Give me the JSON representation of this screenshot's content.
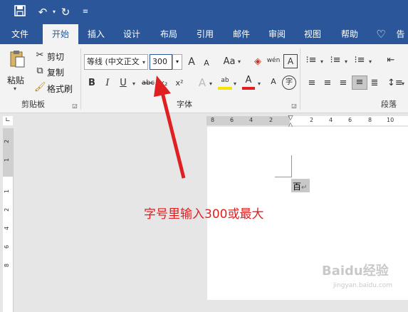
{
  "quick_access": {
    "save": "save-icon",
    "undo": "undo-icon",
    "redo": "redo-icon",
    "customize": "customize-icon"
  },
  "tabs": [
    "文件",
    "开始",
    "插入",
    "设计",
    "布局",
    "引用",
    "邮件",
    "审阅",
    "视图",
    "帮助",
    "告"
  ],
  "active_tab": "开始",
  "clipboard": {
    "paste": "粘贴",
    "cut": "剪切",
    "copy": "复制",
    "format_painter": "格式刷",
    "group_label": "剪贴板"
  },
  "font": {
    "font_name": "等线 (中文正文",
    "font_size": "300",
    "group_label": "字体",
    "bold": "B",
    "italic": "I",
    "underline": "U",
    "strike": "abc",
    "sub": "x₂",
    "sup": "x²",
    "grow": "A",
    "shrink": "A",
    "case": "Aa",
    "phonetic": "wén",
    "char_border": "A",
    "effects": "A",
    "encircle": "字"
  },
  "paragraph": {
    "group_label": "段落"
  },
  "ruler": {
    "h_numbers": [
      "8",
      "6",
      "4",
      "2",
      "2",
      "4",
      "6",
      "8",
      "10"
    ],
    "v_numbers": [
      "2",
      "1",
      "1",
      "2",
      "4",
      "6",
      "8"
    ]
  },
  "document": {
    "text": "百"
  },
  "annotation": {
    "text": "字号里输入300或最大"
  },
  "watermark": {
    "text": "Baidu经验",
    "url": "jingyan.baidu.com"
  },
  "colors": {
    "ribbon_blue": "#2b579a",
    "annotation_red": "#e02020"
  }
}
